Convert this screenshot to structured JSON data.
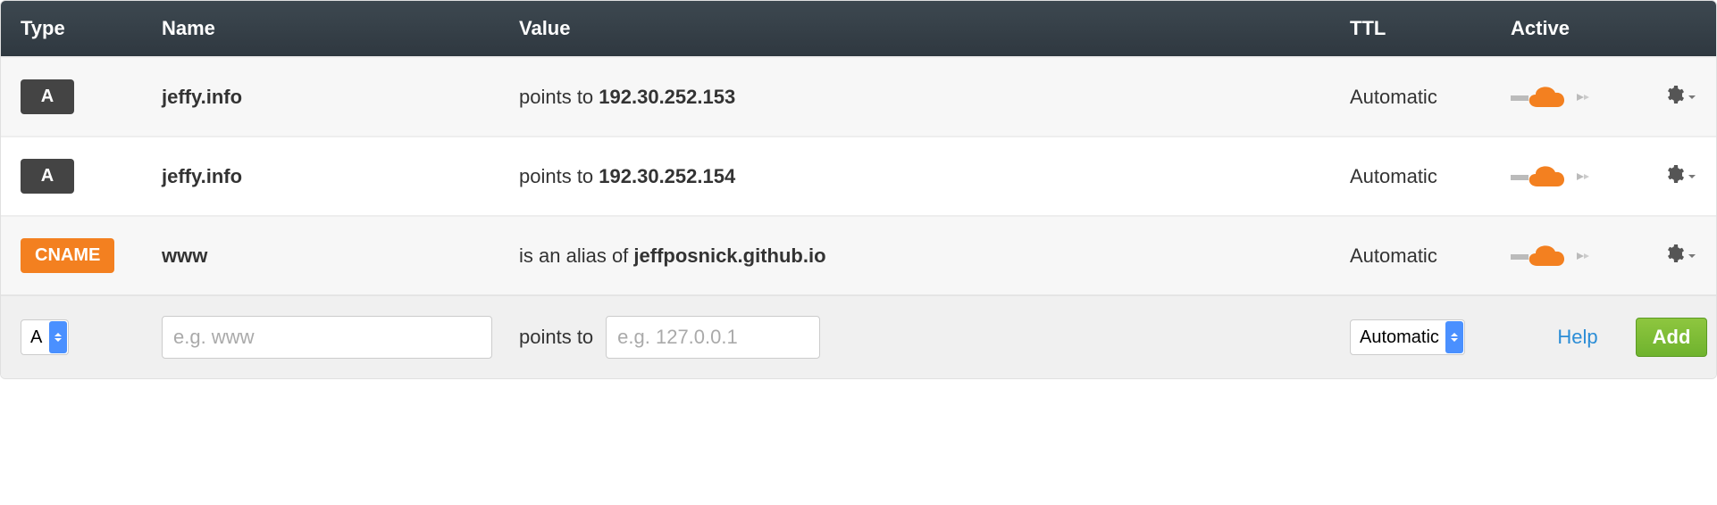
{
  "columns": {
    "type": "Type",
    "name": "Name",
    "value": "Value",
    "ttl": "TTL",
    "active": "Active"
  },
  "records": [
    {
      "type": "A",
      "badgeClass": "a",
      "name": "jeffy.info",
      "prefix": "points to ",
      "target": "192.30.252.153",
      "ttl": "Automatic"
    },
    {
      "type": "A",
      "badgeClass": "a",
      "name": "jeffy.info",
      "prefix": "points to ",
      "target": "192.30.252.154",
      "ttl": "Automatic"
    },
    {
      "type": "CNAME",
      "badgeClass": "cname",
      "name": "www",
      "prefix": "is an alias of ",
      "target": "jeffposnick.github.io",
      "ttl": "Automatic"
    }
  ],
  "addRow": {
    "typeSelected": "A",
    "namePlaceholder": "e.g. www",
    "valuePrefix": "points to",
    "valuePlaceholder": "e.g. 127.0.0.1",
    "ttlSelected": "Automatic",
    "help": "Help",
    "add": "Add"
  }
}
